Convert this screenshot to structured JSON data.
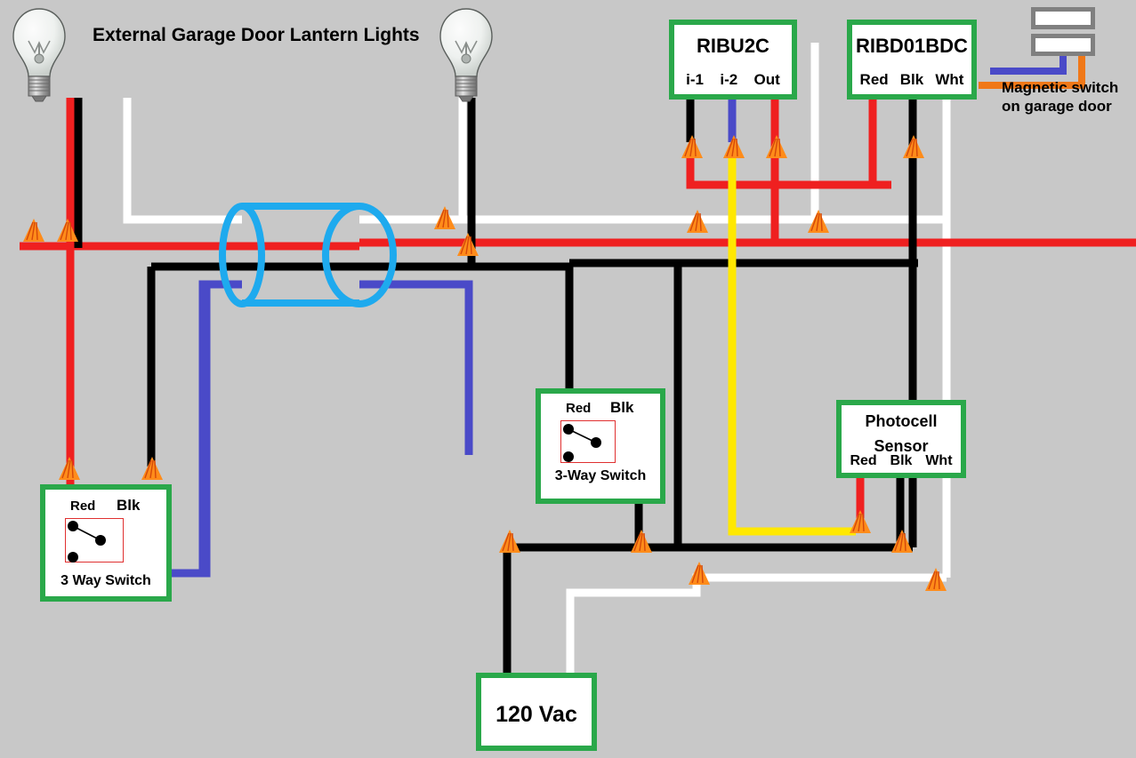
{
  "diagram": {
    "title": "External Garage Door Lantern Lights",
    "background_color": "#c8c8c8",
    "box_border_color": "#2aa84a",
    "wire_nut_color": "#ff8c1a"
  },
  "relays": {
    "ribu2c": {
      "name": "RIBU2C",
      "terminals": [
        "i-1",
        "i-2",
        "Out"
      ]
    },
    "ribd01bdc": {
      "name": "RIBD01BDC",
      "terminals": [
        "Red",
        "Blk",
        "Wht"
      ]
    }
  },
  "photocell": {
    "line1": "Photocell",
    "line2": "Sensor",
    "terminals": [
      "Red",
      "Blk",
      "Wht"
    ]
  },
  "supply": {
    "label": "120 Vac"
  },
  "switches": [
    {
      "caption": "3 Way Switch",
      "terminal_red": "Red",
      "terminal_blk": "Blk"
    },
    {
      "caption": "3-Way Switch",
      "terminal_red": "Red",
      "terminal_blk": "Blk"
    }
  ],
  "magnetic_switch": {
    "label_line1": "Magnetic switch",
    "label_line2": "on garage door",
    "wire_colors": [
      "#4a4ac8",
      "#f07818"
    ]
  },
  "lamps": [
    {
      "name": "left-lantern"
    },
    {
      "name": "right-lantern"
    }
  ],
  "wire_colors": {
    "hot_red": "#ef2020",
    "neutral_white": "#ffffff",
    "ground_black": "#000000",
    "traveler_blue": "#4a4ac8",
    "signal_yellow": "#ffe800",
    "conduit_blue": "#1eaaee",
    "magnet_orange": "#f07818"
  }
}
